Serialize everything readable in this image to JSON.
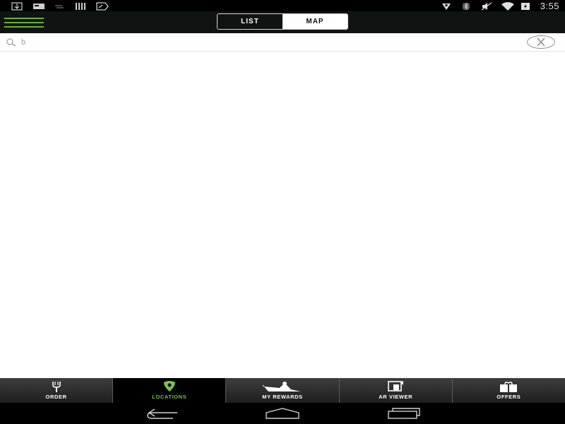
{
  "status_bar": {
    "time": "3:55",
    "left_icons": [
      "download-icon",
      "card-icon",
      "signal-lines-icon",
      "barcode-icon",
      "plane-icon"
    ],
    "right_icons": [
      "location-icon",
      "bluetooth-icon",
      "mute-icon",
      "wifi-icon",
      "battery-icon"
    ]
  },
  "action_bar": {
    "menu_icon": "hamburger-icon",
    "tabs": [
      {
        "label": "LIST",
        "selected": false
      },
      {
        "label": "MAP",
        "selected": true
      }
    ],
    "accent_color": "#6fae3a"
  },
  "search": {
    "value": "b",
    "placeholder": "",
    "search_icon": "search-icon",
    "clear_icon": "close-icon"
  },
  "bottom_nav": {
    "active_color": "#7cc14a",
    "items": [
      {
        "label": "ORDER",
        "icon": "fork-icon",
        "active": false
      },
      {
        "label": "LOCATIONS",
        "icon": "location-pin-icon",
        "active": true
      },
      {
        "label": "MY REWARDS",
        "icon": "rewards-icon",
        "active": false
      },
      {
        "label": "AR VIEWER",
        "icon": "ar-viewer-icon",
        "active": false
      },
      {
        "label": "OFFERS",
        "icon": "gift-icon",
        "active": false
      }
    ]
  },
  "system_nav": {
    "buttons": [
      "back-icon",
      "home-icon",
      "recent-apps-icon"
    ]
  }
}
